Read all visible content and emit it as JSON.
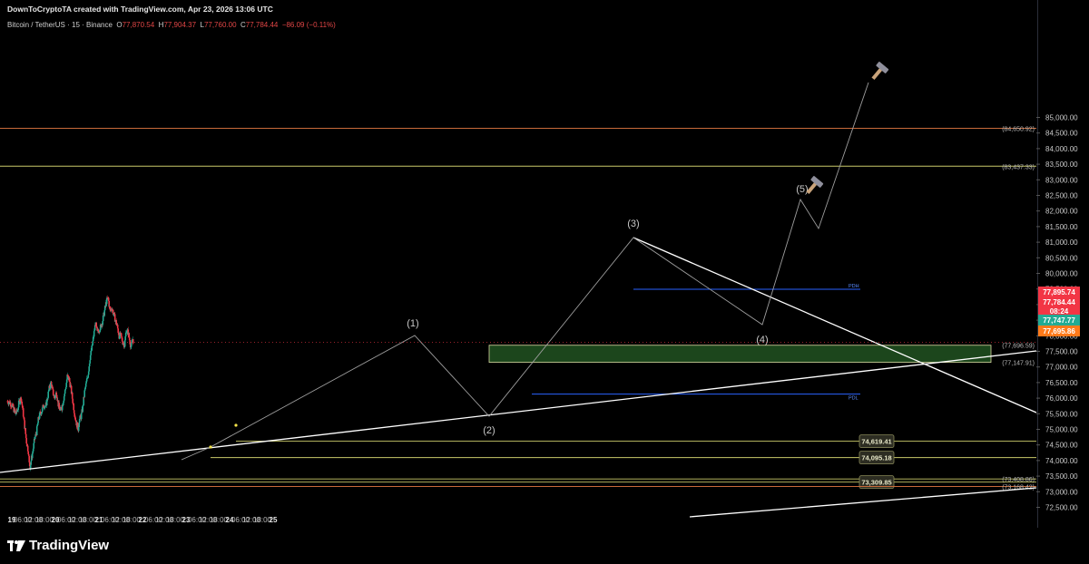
{
  "header": {
    "credit": "DownToCryptoTA created with TradingView.com, Apr 23, 2026 13:06 UTC",
    "symbol": "Bitcoin / TetherUS · 15 · Binance",
    "o_label": "O",
    "o_val": "77,870.54",
    "h_label": "H",
    "h_val": "77,904.37",
    "l_label": "L",
    "l_val": "77,760.00",
    "c_label": "C",
    "c_val": "77,784.44",
    "change": "−86.09 (−0.11%)"
  },
  "brand": {
    "name": "TradingView",
    "icon": "tradingview-logo"
  },
  "colors": {
    "background": "#000000",
    "up": "#22ab94",
    "down": "#f23645",
    "zone_fill": "#1e4a1e",
    "zone_border": "#d8d8a0",
    "level_line": "#c9c96a",
    "pdh_line": "#2962ff",
    "trendline": "#ffffff",
    "wave_path": "#9e9e9e"
  },
  "chart_data": {
    "type": "candlestick",
    "pair": "BTC/USDT",
    "timeframe": "15",
    "exchange": "Binance",
    "y_ticks": [
      "72,500.00",
      "73,000.00",
      "73,500.00",
      "74,000.00",
      "74,500.00",
      "75,000.00",
      "75,500.00",
      "76,000.00",
      "76,500.00",
      "77,000.00",
      "77,500.00",
      "78,000.00",
      "78,500.00",
      "79,000.00",
      "79,500.00",
      "80,000.00",
      "80,500.00",
      "81,000.00",
      "81,500.00",
      "82,000.00",
      "82,500.00",
      "83,000.00",
      "83,500.00",
      "84,000.00",
      "84,500.00",
      "85,000.00"
    ],
    "x_ticks": [
      "19",
      "06:00",
      "12:00",
      "18:00",
      "20",
      "06:00",
      "12:00",
      "18:00",
      "21",
      "06:00",
      "12:00",
      "18:00",
      "22",
      "06:00",
      "12:00",
      "18:00",
      "23",
      "06:00",
      "12:00",
      "18:00",
      "24",
      "06:00",
      "12:00",
      "18:00",
      "25"
    ],
    "ylim": [
      72300,
      85100
    ],
    "price_path": [
      [
        0,
        75900
      ],
      [
        6,
        75850
      ],
      [
        12,
        75700
      ],
      [
        18,
        75500
      ],
      [
        22,
        75600
      ],
      [
        26,
        75900
      ],
      [
        30,
        76000
      ],
      [
        34,
        75600
      ],
      [
        38,
        75100
      ],
      [
        42,
        74600
      ],
      [
        46,
        74300
      ],
      [
        48,
        73900
      ],
      [
        50,
        73800
      ],
      [
        52,
        74000
      ],
      [
        56,
        74300
      ],
      [
        60,
        74700
      ],
      [
        64,
        74900
      ],
      [
        68,
        75300
      ],
      [
        72,
        75500
      ],
      [
        76,
        75600
      ],
      [
        80,
        75800
      ],
      [
        84,
        75700
      ],
      [
        88,
        76000
      ],
      [
        92,
        76300
      ],
      [
        96,
        76500
      ],
      [
        100,
        76200
      ],
      [
        104,
        76000
      ],
      [
        108,
        76200
      ],
      [
        112,
        75800
      ],
      [
        116,
        75600
      ],
      [
        120,
        75700
      ],
      [
        124,
        76000
      ],
      [
        128,
        76300
      ],
      [
        132,
        76700
      ],
      [
        136,
        76600
      ],
      [
        140,
        76300
      ],
      [
        144,
        75900
      ],
      [
        148,
        75500
      ],
      [
        152,
        75200
      ],
      [
        156,
        75000
      ],
      [
        158,
        75300
      ],
      [
        162,
        75400
      ],
      [
        166,
        75700
      ],
      [
        170,
        76200
      ],
      [
        174,
        76500
      ],
      [
        178,
        76800
      ],
      [
        182,
        77300
      ],
      [
        186,
        77600
      ],
      [
        190,
        78000
      ],
      [
        194,
        78400
      ],
      [
        198,
        78100
      ],
      [
        202,
        78200
      ],
      [
        206,
        78300
      ],
      [
        210,
        78500
      ],
      [
        214,
        78800
      ],
      [
        218,
        79100
      ],
      [
        222,
        79200
      ],
      [
        226,
        78800
      ],
      [
        230,
        78900
      ],
      [
        234,
        78700
      ],
      [
        238,
        78500
      ],
      [
        242,
        78300
      ],
      [
        246,
        78000
      ],
      [
        250,
        78000
      ],
      [
        254,
        77800
      ],
      [
        258,
        77700
      ],
      [
        262,
        78200
      ],
      [
        266,
        78100
      ],
      [
        270,
        77800
      ],
      [
        272,
        77650
      ],
      [
        274,
        77750
      ],
      [
        276,
        77900
      ],
      [
        278,
        77784
      ]
    ],
    "price_path_x_unit": "15-min bars after Apr 19 00:00",
    "horizontal_levels": [
      {
        "price": 84650.92,
        "label": "(84,650.92)"
      },
      {
        "price": 83437.33,
        "label": "(83,437.33)"
      },
      {
        "price": 77696.59,
        "label": "(77,696.59)"
      },
      {
        "price": 77147.91,
        "label": "(77,147.91)"
      },
      {
        "price": 74619.41,
        "label": "74,619.41"
      },
      {
        "price": 74095.18,
        "label": "74,095.18"
      },
      {
        "price": 73408.86,
        "label": "(73,408.86)"
      },
      {
        "price": 73309.85,
        "label": "73,309.85"
      },
      {
        "price": 73168.42,
        "label": "(73,168.42)"
      }
    ],
    "demand_zone": {
      "from": 77147.91,
      "to": 77696.59
    },
    "pdh": {
      "price": 79490,
      "label": "PDH"
    },
    "pdl": {
      "price": 76130,
      "label": "PDL"
    },
    "wave_labels": [
      {
        "label": "(1)",
        "time": "Apr 21 09:00",
        "price": 76750
      },
      {
        "label": "(2)",
        "time": "Apr 21 19:30",
        "price": 74850
      },
      {
        "label": "(3)",
        "time": "Apr 22 15:30",
        "price": 79450
      },
      {
        "label": "(4)",
        "time": "Apr 23 10:30",
        "price": 77150
      },
      {
        "label": "(5)",
        "time": "Apr 23 18:30",
        "price": 80500
      }
    ],
    "right_axis_tags": [
      {
        "value": "77,895.74",
        "color": "#f23645"
      },
      {
        "value": "77,784.44",
        "color": "#f23645"
      },
      {
        "value": "08:24",
        "color": "#f23645"
      },
      {
        "value": "77,747.77",
        "color": "#22ab94"
      },
      {
        "value": "77,695.86",
        "color": "#ff7a1a"
      }
    ]
  }
}
